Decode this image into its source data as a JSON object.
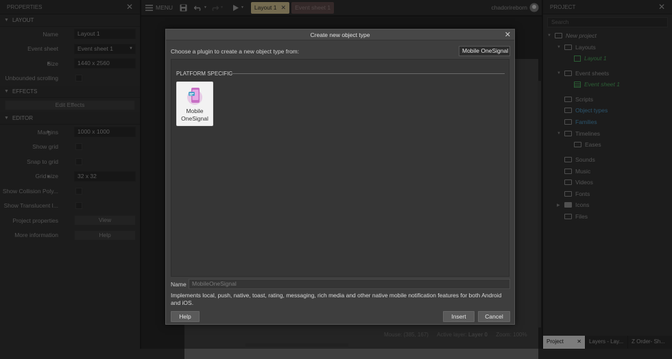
{
  "properties": {
    "header": "PROPERTIES",
    "sections": {
      "layout": "LAYOUT",
      "effects": "EFFECTS",
      "editor": "EDITOR"
    },
    "layout_rows": [
      {
        "label": "Name",
        "value": "Layout 1"
      },
      {
        "label": "Event sheet",
        "value": "Event sheet 1"
      },
      {
        "label": "Size",
        "value": "1440 x 2560"
      },
      {
        "label": "Unbounded scrolling",
        "value": ""
      }
    ],
    "edit_effects": "Edit Effects",
    "editor_rows": [
      {
        "label": "Margins",
        "value": "1000 x 1000"
      },
      {
        "label": "Show grid",
        "value": ""
      },
      {
        "label": "Snap to grid",
        "value": ""
      },
      {
        "label": "Grid size",
        "value": "32 x 32"
      },
      {
        "label": "Show Collision Poly...",
        "value": ""
      },
      {
        "label": "Show Translucent I...",
        "value": ""
      },
      {
        "label": "Project properties",
        "value": "View"
      },
      {
        "label": "More information",
        "value": "Help"
      }
    ]
  },
  "toolbar": {
    "menu_label": "MENU",
    "tabs": [
      {
        "label": "Layout 1"
      },
      {
        "label": "Event sheet 1"
      }
    ],
    "user": "chadorireborn"
  },
  "status": {
    "mouse": "Mouse: (385, 167)",
    "active_layer_label": "Active layer:",
    "active_layer": "Layer 0",
    "zoom": "Zoom: 100%"
  },
  "project": {
    "header": "PROJECT",
    "search_placeholder": "Search",
    "tree": [
      {
        "label": "New project",
        "style": "italic"
      },
      {
        "label": "Layouts"
      },
      {
        "label": "Layout 1",
        "style": "green"
      },
      {
        "label": "Event sheets"
      },
      {
        "label": "Event sheet 1",
        "style": "green"
      },
      {
        "label": "Scripts"
      },
      {
        "label": "Object types",
        "style": "blue"
      },
      {
        "label": "Families",
        "style": "blue"
      },
      {
        "label": "Timelines"
      },
      {
        "label": "Eases"
      },
      {
        "label": "Sounds"
      },
      {
        "label": "Music"
      },
      {
        "label": "Videos"
      },
      {
        "label": "Fonts"
      },
      {
        "label": "Icons"
      },
      {
        "label": "Files"
      }
    ],
    "bottom_tabs": [
      "Project",
      "Layers - Lay...",
      "Z Order- Sh..."
    ]
  },
  "dialog": {
    "title": "Create new object type",
    "prompt": "Choose a plugin to create a new object type from:",
    "search_value": "Mobile OneSignal",
    "category": "PLATFORM SPECIFIC",
    "plugin": {
      "line1": "Mobile",
      "line2": "OneSignal"
    },
    "name_label": "Name",
    "name_value": "MobileOneSignal",
    "description": "Implements local, push, native, toast, rating, messaging, rich media and other native mobile notification features for both Android and iOS.",
    "help": "Help",
    "insert": "Insert",
    "cancel": "Cancel"
  },
  "colors": {
    "accent_green": "#4aa05a",
    "accent_blue": "#4a8fb8",
    "active_tab": "#c8b98a"
  }
}
